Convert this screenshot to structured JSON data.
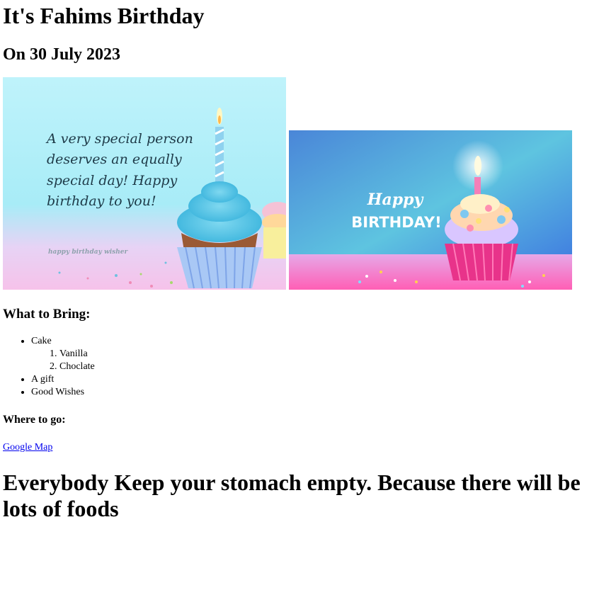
{
  "title": "It's Fahims Birthday",
  "date": "On 30 July 2023",
  "images": {
    "card1": {
      "message": [
        "A very special person",
        "deserves an equally",
        "special day! Happy",
        "birthday to you!"
      ],
      "watermark": "happy birthday wisher"
    },
    "card2": {
      "line1": "Happy",
      "line2": "BIRTHDAY!"
    }
  },
  "bring_heading": "What to Bring:",
  "bring_items": {
    "cake": "Cake",
    "cake_options": [
      "Vanilla",
      "Choclate"
    ],
    "gift": "A gift",
    "wishes": "Good Wishes"
  },
  "where_heading": "Where to go:",
  "map_link": "Google Map",
  "closing": "Everybody Keep your stomach empty. Because there will be lots of foods"
}
